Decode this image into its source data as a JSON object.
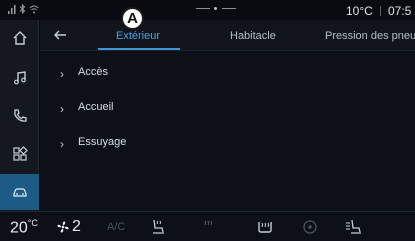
{
  "status": {
    "temperature": "10°C",
    "time": "07:5"
  },
  "callout": {
    "letter": "A"
  },
  "sidebar": {
    "items": [
      {
        "icon": "home-icon",
        "active": false
      },
      {
        "icon": "music-icon",
        "active": false
      },
      {
        "icon": "phone-icon",
        "active": false
      },
      {
        "icon": "apps-icon",
        "active": false
      },
      {
        "icon": "car-icon",
        "active": true
      }
    ]
  },
  "tabs": {
    "exterieur": "Extérieur",
    "habitacle": "Habitacle",
    "pression": "Pression des pneus"
  },
  "list": {
    "items": [
      "Accès",
      "Accueil",
      "Essuyage"
    ]
  },
  "climate": {
    "temperature": "20",
    "temperature_unit": "°C",
    "fan_level": "2",
    "ac_label": "A/C"
  },
  "colors": {
    "accent": "#3d97d8",
    "active_sidebar": "#1d5b87",
    "background": "#0b0d12"
  }
}
